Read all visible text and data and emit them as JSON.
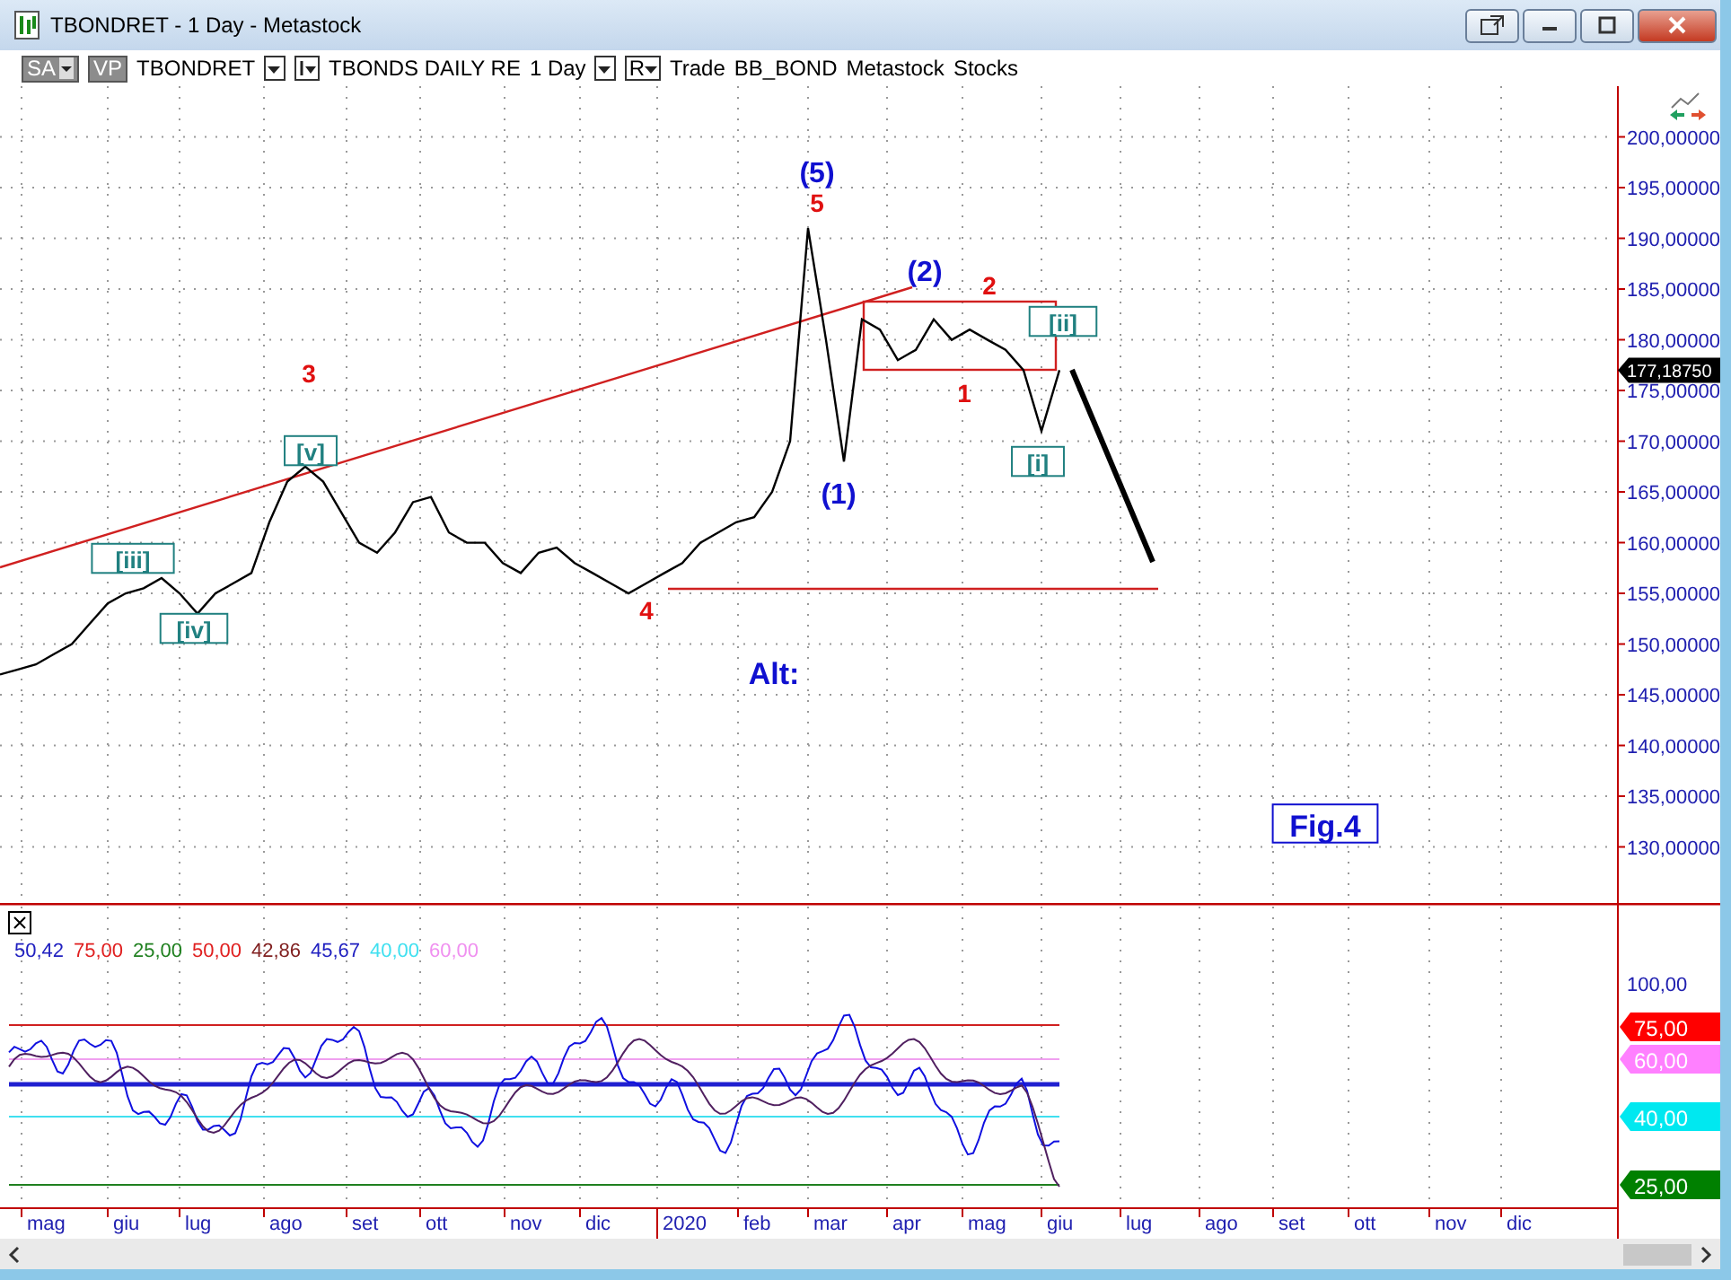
{
  "window": {
    "title": "TBONDRET - 1 Day - Metastock"
  },
  "toolbar": [
    {
      "kind": "chip",
      "label": "SA",
      "caret": true
    },
    {
      "kind": "chip",
      "label": "VP",
      "caret": false
    },
    {
      "kind": "text",
      "label": "TBONDRET"
    },
    {
      "kind": "dropdown"
    },
    {
      "kind": "bar-dropdown"
    },
    {
      "kind": "text",
      "label": "TBONDS DAILY RE"
    },
    {
      "kind": "text",
      "label": "1 Day"
    },
    {
      "kind": "dropdown"
    },
    {
      "kind": "dropdown",
      "label": "R"
    },
    {
      "kind": "text",
      "label": "Trade"
    },
    {
      "kind": "text",
      "label": "BB_BOND"
    },
    {
      "kind": "text",
      "label": "Metastock"
    },
    {
      "kind": "text",
      "label": "Stocks"
    }
  ],
  "price_pane": {
    "last_price": "177,18750",
    "axis_labels": [
      "200,00000",
      "195,00000",
      "190,00000",
      "185,00000",
      "180,00000",
      "175,00000",
      "170,00000",
      "165,00000",
      "160,00000",
      "155,00000",
      "150,00000",
      "145,00000",
      "140,00000",
      "135,00000",
      "130,00000"
    ],
    "wave_labels": [
      {
        "text": "(5)",
        "kind": "major"
      },
      {
        "text": "5",
        "kind": "minor"
      },
      {
        "text": "(2)",
        "kind": "major"
      },
      {
        "text": "2",
        "kind": "minor"
      },
      {
        "text": "[ii]",
        "kind": "sub"
      },
      {
        "text": "1",
        "kind": "minor"
      },
      {
        "text": "[i]",
        "kind": "sub"
      },
      {
        "text": "(1)",
        "kind": "major"
      },
      {
        "text": "3",
        "kind": "minor"
      },
      {
        "text": "[v]",
        "kind": "sub"
      },
      {
        "text": "[iii]",
        "kind": "sub"
      },
      {
        "text": "[iv]",
        "kind": "sub"
      },
      {
        "text": "4",
        "kind": "minor"
      },
      {
        "text": "Alt:",
        "kind": "note"
      },
      {
        "text": "Fig.4",
        "kind": "boxed-note"
      }
    ]
  },
  "date_axis": [
    "mag",
    "giu",
    "lug",
    "ago",
    "set",
    "ott",
    "nov",
    "dic",
    "2020",
    "feb",
    "mar",
    "apr",
    "mag",
    "giu",
    "lug",
    "ago",
    "set",
    "ott",
    "nov",
    "dic"
  ],
  "indicator_pane": {
    "legend": [
      {
        "text": "50,42",
        "color": "#2020c0"
      },
      {
        "text": "75,00",
        "color": "#e02020"
      },
      {
        "text": "25,00",
        "color": "#208020"
      },
      {
        "text": "50,00",
        "color": "#e02020"
      },
      {
        "text": "42,86",
        "color": "#802020"
      },
      {
        "text": "45,67",
        "color": "#2020c0"
      },
      {
        "text": "40,00",
        "color": "#40e0f0"
      },
      {
        "text": "60,00",
        "color": "#f090f0"
      }
    ],
    "axis_labels": [
      "100,00"
    ],
    "tags": [
      {
        "text": "75,00",
        "color": "#ff0000"
      },
      {
        "text": "60,00",
        "color": "#ff80ff"
      },
      {
        "text": "40,00",
        "color": "#00e8f0"
      },
      {
        "text": "25,00",
        "color": "#008000"
      }
    ]
  }
}
